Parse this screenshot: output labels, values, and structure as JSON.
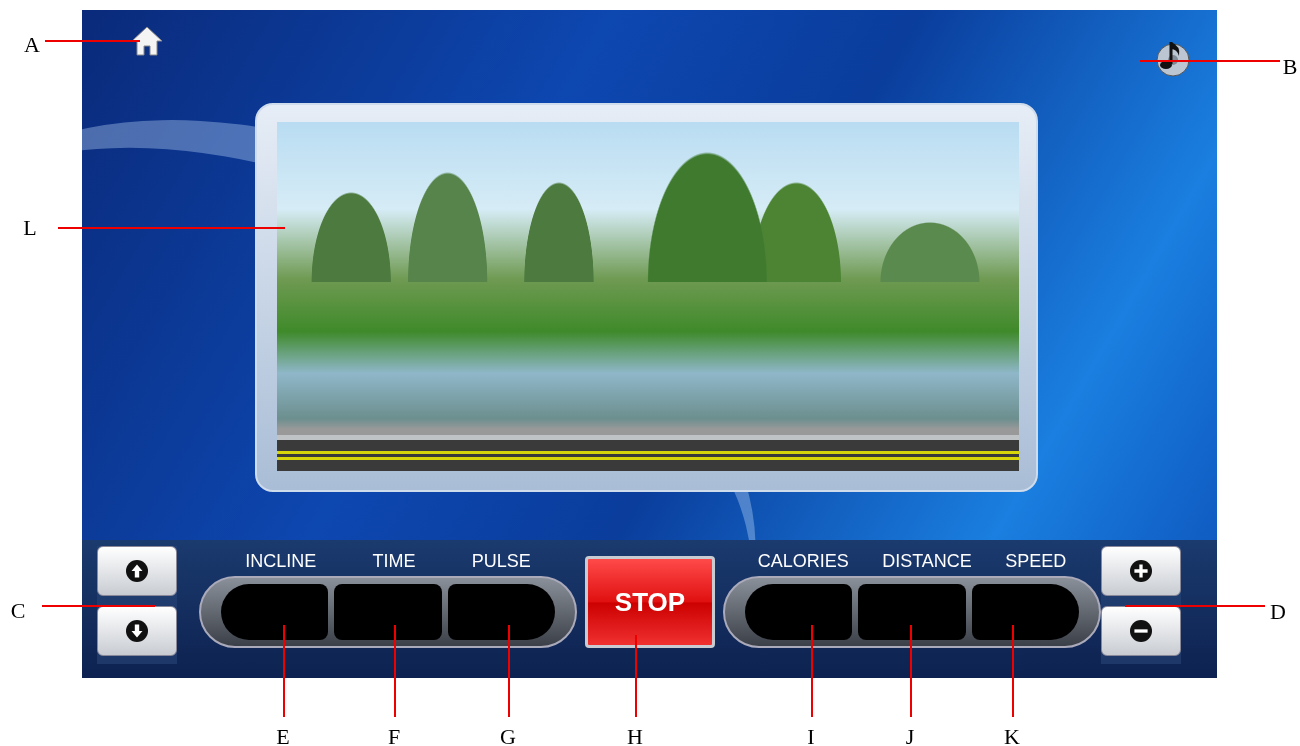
{
  "callouts": [
    {
      "letter": "A"
    },
    {
      "letter": "B"
    },
    {
      "letter": "L"
    },
    {
      "letter": "C"
    },
    {
      "letter": "D"
    },
    {
      "letter": "E"
    },
    {
      "letter": "F"
    },
    {
      "letter": "G"
    },
    {
      "letter": "H"
    },
    {
      "letter": "I"
    },
    {
      "letter": "J"
    },
    {
      "letter": "K"
    }
  ],
  "left_displays": [
    {
      "label": "INCLINE"
    },
    {
      "label": "TIME"
    },
    {
      "label": "PULSE"
    }
  ],
  "stop_button": {
    "label": "STOP"
  },
  "right_displays": [
    {
      "label": "CALORIES"
    },
    {
      "label": "DISTANCE"
    },
    {
      "label": "SPEED"
    }
  ]
}
